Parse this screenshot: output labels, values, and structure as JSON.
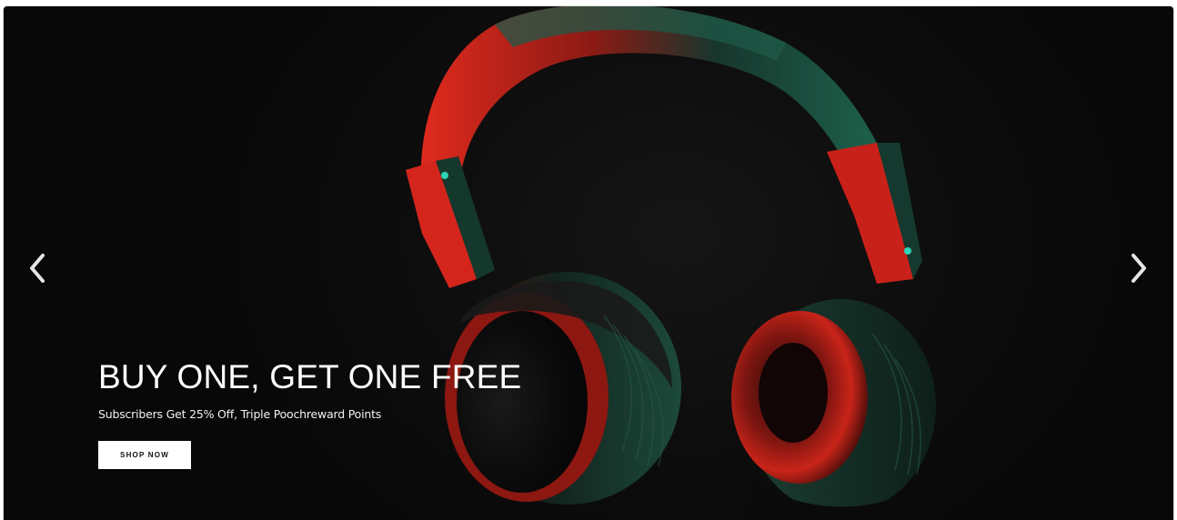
{
  "banner": {
    "headline": "BUY ONE, GET ONE FREE",
    "subheadline": "Subscribers Get 25% Off, Triple Poochreward Points",
    "cta_label": "SHOP NOW",
    "image": "headphones-red-green",
    "prev_icon": "chevron-left-icon",
    "next_icon": "chevron-right-icon"
  },
  "colors": {
    "background": "#0b0b0b",
    "accent_red": "#d4231c",
    "accent_green": "#1e5a45",
    "text": "#ffffff",
    "button_bg": "#ffffff",
    "button_text": "#111111"
  }
}
